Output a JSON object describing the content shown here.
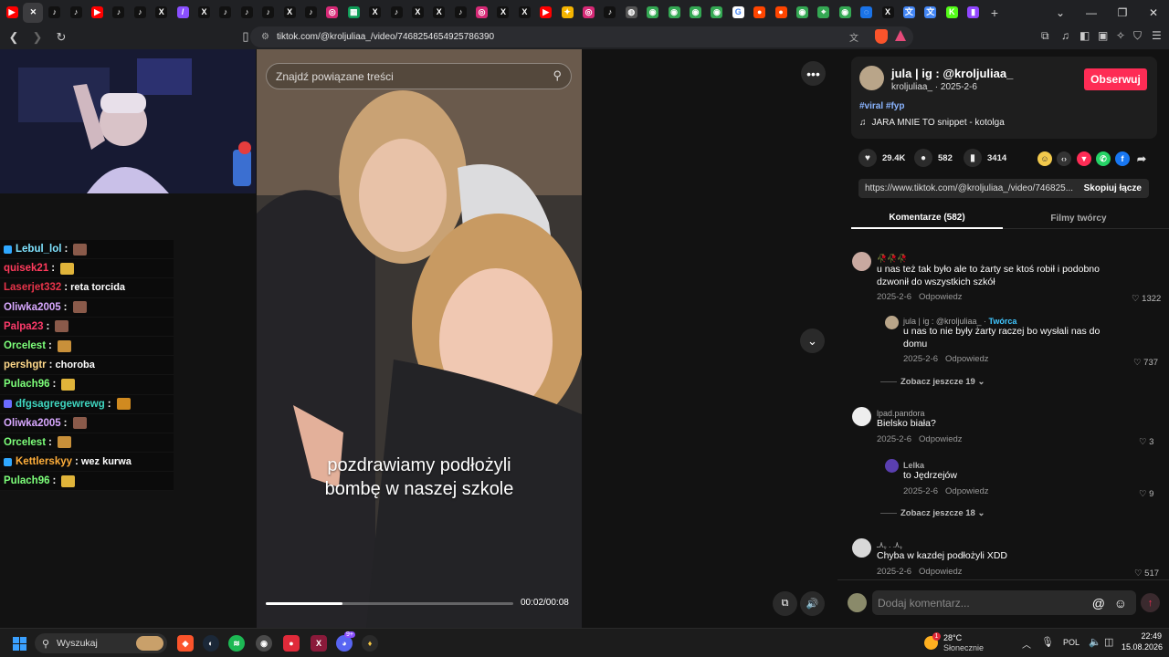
{
  "browser": {
    "tabs": [
      {
        "icon": "youtube-icon",
        "color": "#ff0000",
        "glyph": "▶"
      },
      {
        "icon": "close-icon",
        "color": "#3c3c3f",
        "glyph": "✕",
        "active": true
      },
      {
        "icon": "tiktok-icon",
        "color": "#111111",
        "glyph": "♪"
      },
      {
        "icon": "tiktok-icon",
        "color": "#111111",
        "glyph": "♪"
      },
      {
        "icon": "youtube-icon",
        "color": "#ff0000",
        "glyph": "▶"
      },
      {
        "icon": "tiktok-icon",
        "color": "#111111",
        "glyph": "♪"
      },
      {
        "icon": "tiktok-icon",
        "color": "#111111",
        "glyph": "♪"
      },
      {
        "icon": "x-icon",
        "color": "#111111",
        "glyph": "X"
      },
      {
        "icon": "pen-icon",
        "color": "#8a4fff",
        "glyph": "/"
      },
      {
        "icon": "x-icon",
        "color": "#111111",
        "glyph": "X"
      },
      {
        "icon": "tiktok-icon",
        "color": "#111111",
        "glyph": "♪"
      },
      {
        "icon": "tiktok-icon",
        "color": "#111111",
        "glyph": "♪"
      },
      {
        "icon": "tiktok-icon",
        "color": "#111111",
        "glyph": "♪"
      },
      {
        "icon": "x-icon",
        "color": "#111111",
        "glyph": "X"
      },
      {
        "icon": "tiktok-icon",
        "color": "#111111",
        "glyph": "♪"
      },
      {
        "icon": "instagram-icon",
        "color": "#d62976",
        "glyph": "◎"
      },
      {
        "icon": "sheets-icon",
        "color": "#0f9d58",
        "glyph": "▦"
      },
      {
        "icon": "x-icon",
        "color": "#111111",
        "glyph": "X"
      },
      {
        "icon": "tiktok-icon",
        "color": "#111111",
        "glyph": "♪"
      },
      {
        "icon": "x-icon",
        "color": "#111111",
        "glyph": "X"
      },
      {
        "icon": "x-icon",
        "color": "#111111",
        "glyph": "X"
      },
      {
        "icon": "tiktok-icon",
        "color": "#111111",
        "glyph": "♪"
      },
      {
        "icon": "instagram-icon",
        "color": "#d62976",
        "glyph": "◎"
      },
      {
        "icon": "x-icon",
        "color": "#111111",
        "glyph": "X"
      },
      {
        "icon": "x-icon",
        "color": "#111111",
        "glyph": "X"
      },
      {
        "icon": "youtube-icon",
        "color": "#ff0000",
        "glyph": "▶"
      },
      {
        "icon": "pinwheel-icon",
        "color": "#f4b400",
        "glyph": "✦"
      },
      {
        "icon": "instagram-icon",
        "color": "#d62976",
        "glyph": "◎"
      },
      {
        "icon": "tiktok-icon",
        "color": "#111111",
        "glyph": "♪"
      },
      {
        "icon": "globe-icon",
        "color": "#555555",
        "glyph": "◍"
      },
      {
        "icon": "chrome-icon",
        "color": "#34a853",
        "glyph": "◉"
      },
      {
        "icon": "chrome-icon",
        "color": "#34a853",
        "glyph": "◉"
      },
      {
        "icon": "chrome-icon",
        "color": "#34a853",
        "glyph": "◉"
      },
      {
        "icon": "chrome-icon",
        "color": "#34a853",
        "glyph": "◉"
      },
      {
        "icon": "google-icon",
        "color": "#ffffff",
        "glyph": "G"
      },
      {
        "icon": "reddit-icon",
        "color": "#ff4500",
        "glyph": "●"
      },
      {
        "icon": "reddit-icon",
        "color": "#ff4500",
        "glyph": "●"
      },
      {
        "icon": "chrome-icon",
        "color": "#34a853",
        "glyph": "◉"
      },
      {
        "icon": "maps-icon",
        "color": "#34a853",
        "glyph": "⌖"
      },
      {
        "icon": "chrome-icon",
        "color": "#34a853",
        "glyph": "◉"
      },
      {
        "icon": "loading-icon",
        "color": "#1a73e8",
        "glyph": "◌"
      },
      {
        "icon": "x-icon",
        "color": "#111111",
        "glyph": "X"
      },
      {
        "icon": "translate-icon",
        "color": "#4285f4",
        "glyph": "文"
      },
      {
        "icon": "translate-icon",
        "color": "#4285f4",
        "glyph": "文"
      },
      {
        "icon": "kick-icon",
        "color": "#53fc18",
        "glyph": "K"
      },
      {
        "icon": "twitch-icon",
        "color": "#9146ff",
        "glyph": "▮"
      }
    ],
    "new_tab_glyph": "+",
    "url": "tiktok.com/@kroljuliaa_/video/7468254654925786390"
  },
  "chat": [
    {
      "user": "Lebul_lol",
      "color": "#7fe3ff",
      "msg": "",
      "emote": "#8a5a4a",
      "badge": "#2fa8ff"
    },
    {
      "user": "quisek21",
      "color": "#ff3b5c",
      "msg": "",
      "emote": "#e0b43a"
    },
    {
      "user": "Laserjet332",
      "color": "#e8344a",
      "msg": "reta torcida",
      "emote": ""
    },
    {
      "user": "Oliwka2005",
      "color": "#d8a8ff",
      "msg": "",
      "emote": "#8a5a4a"
    },
    {
      "user": "Palpa23",
      "color": "#ff3b6b",
      "msg": "",
      "emote": "#8a5a4a"
    },
    {
      "user": "Orcelest",
      "color": "#7dff7a",
      "msg": "",
      "emote": "#c8903a"
    },
    {
      "user": "pershgtr",
      "color": "#ffd98a",
      "msg": "choroba",
      "emote": ""
    },
    {
      "user": "Pulach96",
      "color": "#7dff7a",
      "msg": "",
      "emote": "#e0b43a"
    },
    {
      "user": "dfgsagregewrewg",
      "color": "#3fd6c0",
      "msg": "",
      "emote": "#d08a20",
      "badge": "#6b6bff"
    },
    {
      "user": "Oliwka2005",
      "color": "#d8a8ff",
      "msg": "",
      "emote": "#8a5a4a"
    },
    {
      "user": "Orcelest",
      "color": "#7dff7a",
      "msg": "",
      "emote": "#c8903a"
    },
    {
      "user": "Kettlerskyy",
      "color": "#ffae3a",
      "msg": "wez kurwa",
      "emote": "",
      "badge": "#2fa8ff"
    },
    {
      "user": "Pulach96",
      "color": "#7dff7a",
      "msg": "",
      "emote": "#e0b43a"
    }
  ],
  "video": {
    "search_placeholder": "Znajdź powiązane treści",
    "subtitle_line1": "pozdrawiamy podłożyli",
    "subtitle_line2": "bombę w naszej szkole",
    "time": "00:02/00:08",
    "progress": 0.31
  },
  "author": {
    "display_name": "jula | ig : @kroljuliaa_",
    "handle": "kroljuliaa_",
    "date": "2025-2-6",
    "follow_label": "Obserwuj",
    "hashtags": "#viral #fyp",
    "music": "JARA MNIE TO snippet - kotolga"
  },
  "actions": {
    "likes": "29.4K",
    "comments": "582",
    "saves": "3414"
  },
  "share": {
    "link": "https://www.tiktok.com/@kroljuliaa_/video/746825...",
    "copy_label": "Skopiuj łącze"
  },
  "panel_tabs": {
    "comments": "Komentarze (582)",
    "creator_videos": "Filmy twórcy"
  },
  "comments": {
    "c1": {
      "name": "🥀🥀🥀",
      "line1": "u nas też tak było ale to żarty se ktoś robił i podobno",
      "line2": "dzwonił do wszystkich szkół",
      "date": "2025-2-6",
      "reply": "Odpowiedz",
      "likes": "1322"
    },
    "r1": {
      "name": "jula | ig : @kroljuliaa_",
      "creator": "Twórca",
      "line1": "u nas to nie były żarty raczej bo wysłali nas do",
      "line2": "domu",
      "date": "2025-2-6",
      "reply": "Odpowiedz",
      "likes": "737"
    },
    "more1": "Zobacz jeszcze 19",
    "c2": {
      "name": "lpad.pandora",
      "line1": "Bielsko biała?",
      "date": "2025-2-6",
      "reply": "Odpowiedz",
      "likes": "3"
    },
    "r2": {
      "name": "Lelka",
      "line1": "to Jędrzejów",
      "date": "2025-2-6",
      "reply": "Odpowiedz",
      "likes": "9"
    },
    "more2": "Zobacz jeszcze 18",
    "c3": {
      "name": "ﮩ٨ـ . ﮩ٨ـ",
      "line1": "Chyba w kazdej podłożyli XDD",
      "date": "2025-2-6",
      "reply": "Odpowiedz",
      "likes": "517"
    }
  },
  "comment_input_placeholder": "Dodaj komentarz...",
  "taskbar": {
    "search_label": "Wyszukaj",
    "weather_temp": "28°C",
    "weather_desc": "Słonecznie",
    "weather_badge": "1",
    "lang": "POL",
    "time": "22:49",
    "date": "15.08.2026",
    "discord_badge": "9+"
  }
}
